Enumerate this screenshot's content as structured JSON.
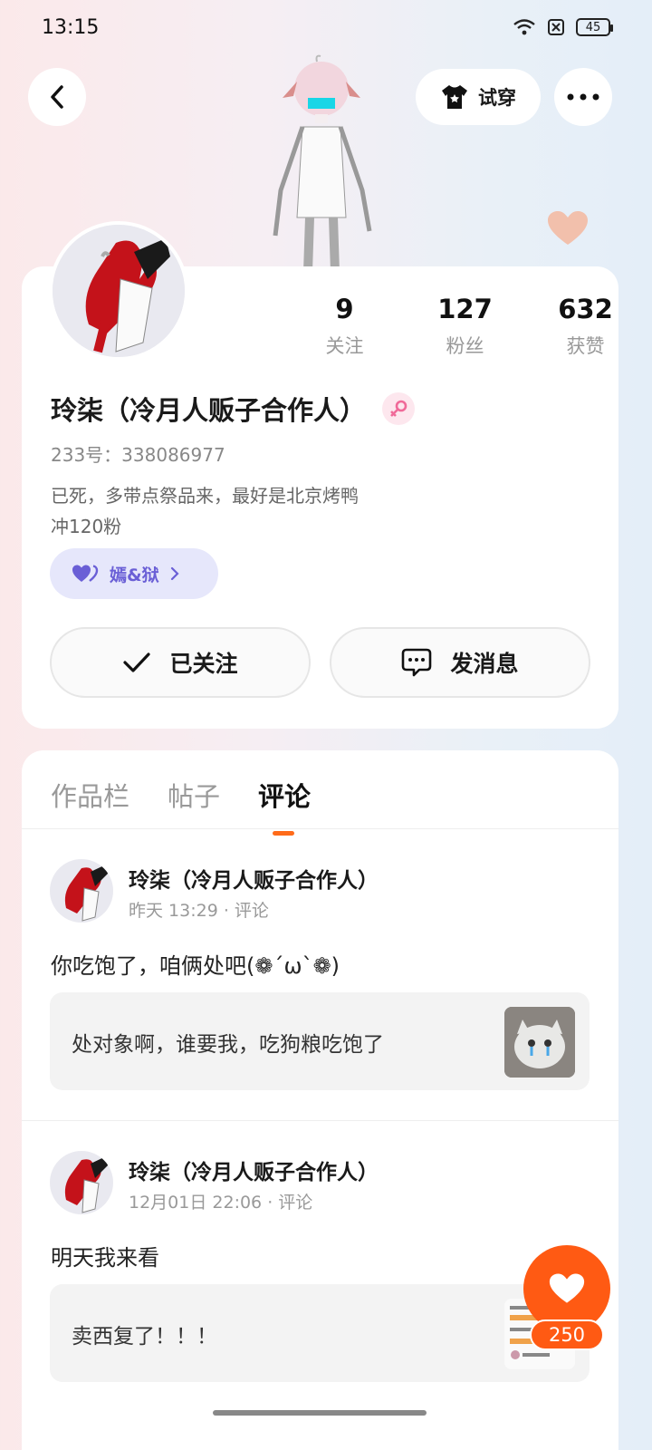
{
  "status": {
    "time": "13:15",
    "battery": "45"
  },
  "header": {
    "tryon_label": "试穿"
  },
  "profile": {
    "stats": [
      {
        "num": "9",
        "label": "关注"
      },
      {
        "num": "127",
        "label": "粉丝"
      },
      {
        "num": "632",
        "label": "获赞"
      }
    ],
    "name": "玲柒（冷月人贩子合作人）",
    "uid": "233号：338086977",
    "bio_line1": "已死，多带点祭品来，最好是北京烤鸭",
    "bio_line2": "冲120粉",
    "tag": "嫣&狱",
    "follow_label": "已关注",
    "message_label": "发消息"
  },
  "tabs": [
    "作品栏",
    "帖子",
    "评论"
  ],
  "posts": [
    {
      "name": "玲柒（冷月人贩子合作人）",
      "meta": "昨天 13:29 · 评论",
      "text": "你吃饱了，咱俩处吧(❁´ω`❁)",
      "quote": "处对象啊，谁要我，吃狗粮吃饱了"
    },
    {
      "name": "玲柒（冷月人贩子合作人）",
      "meta": "12月01日 22:06 · 评论",
      "text": "明天我来看",
      "quote": "卖西复了！！！"
    }
  ],
  "like": {
    "count": "250"
  },
  "colors": {
    "accent": "#ff5a13",
    "tag_bg": "#e6e7fb",
    "tag_fg": "#6a5fd6"
  }
}
